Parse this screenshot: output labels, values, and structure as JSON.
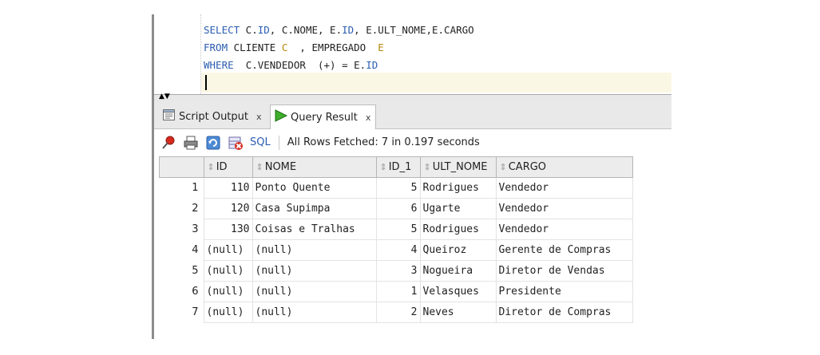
{
  "editor": {
    "lines": [
      [
        {
          "t": "SELECT",
          "k": "kw"
        },
        {
          "t": " C.",
          "k": ""
        },
        {
          "t": "ID",
          "k": "kw"
        },
        {
          "t": ", C.NOME, E.",
          "k": ""
        },
        {
          "t": "ID",
          "k": "kw"
        },
        {
          "t": ", E.ULT_NOME,E.CARGO",
          "k": ""
        }
      ],
      [
        {
          "t": "FROM",
          "k": "kw"
        },
        {
          "t": " CLIENTE ",
          "k": ""
        },
        {
          "t": "C",
          "k": "al"
        },
        {
          "t": "  , EMPREGADO  ",
          "k": ""
        },
        {
          "t": "E",
          "k": "al"
        }
      ],
      [
        {
          "t": "WHERE",
          "k": "kw"
        },
        {
          "t": "  C.VENDEDOR  (+) = E.",
          "k": ""
        },
        {
          "t": "ID",
          "k": "kw"
        }
      ]
    ]
  },
  "tabs": {
    "script_output": "Script Output",
    "query_result": "Query Result",
    "close": "x"
  },
  "toolbar": {
    "sql": "SQL",
    "status": "All Rows Fetched: 7 in 0.197 seconds"
  },
  "grid": {
    "headers": [
      "ID",
      "NOME",
      "ID_1",
      "ULT_NOME",
      "CARGO"
    ],
    "rows": [
      {
        "n": "1",
        "id": "110",
        "nome": "Ponto Quente",
        "id1": "5",
        "ult": "Rodrigues",
        "cargo": "Vendedor"
      },
      {
        "n": "2",
        "id": "120",
        "nome": "Casa Supimpa",
        "id1": "6",
        "ult": "Ugarte",
        "cargo": "Vendedor"
      },
      {
        "n": "3",
        "id": "130",
        "nome": "Coisas e Tralhas",
        "id1": "5",
        "ult": "Rodrigues",
        "cargo": "Vendedor"
      },
      {
        "n": "4",
        "id": "(null)",
        "nome": "(null)",
        "id1": "4",
        "ult": "Queiroz",
        "cargo": "Gerente de Compras"
      },
      {
        "n": "5",
        "id": "(null)",
        "nome": "(null)",
        "id1": "3",
        "ult": "Nogueira",
        "cargo": "Diretor de Vendas"
      },
      {
        "n": "6",
        "id": "(null)",
        "nome": "(null)",
        "id1": "1",
        "ult": "Velasques",
        "cargo": "Presidente"
      },
      {
        "n": "7",
        "id": "(null)",
        "nome": "(null)",
        "id1": "2",
        "ult": "Neves",
        "cargo": "Diretor de Compras"
      }
    ]
  },
  "colors": {
    "keyword": "#2a5db0",
    "alias": "#b8860b",
    "current_line": "#fbf7e5"
  }
}
